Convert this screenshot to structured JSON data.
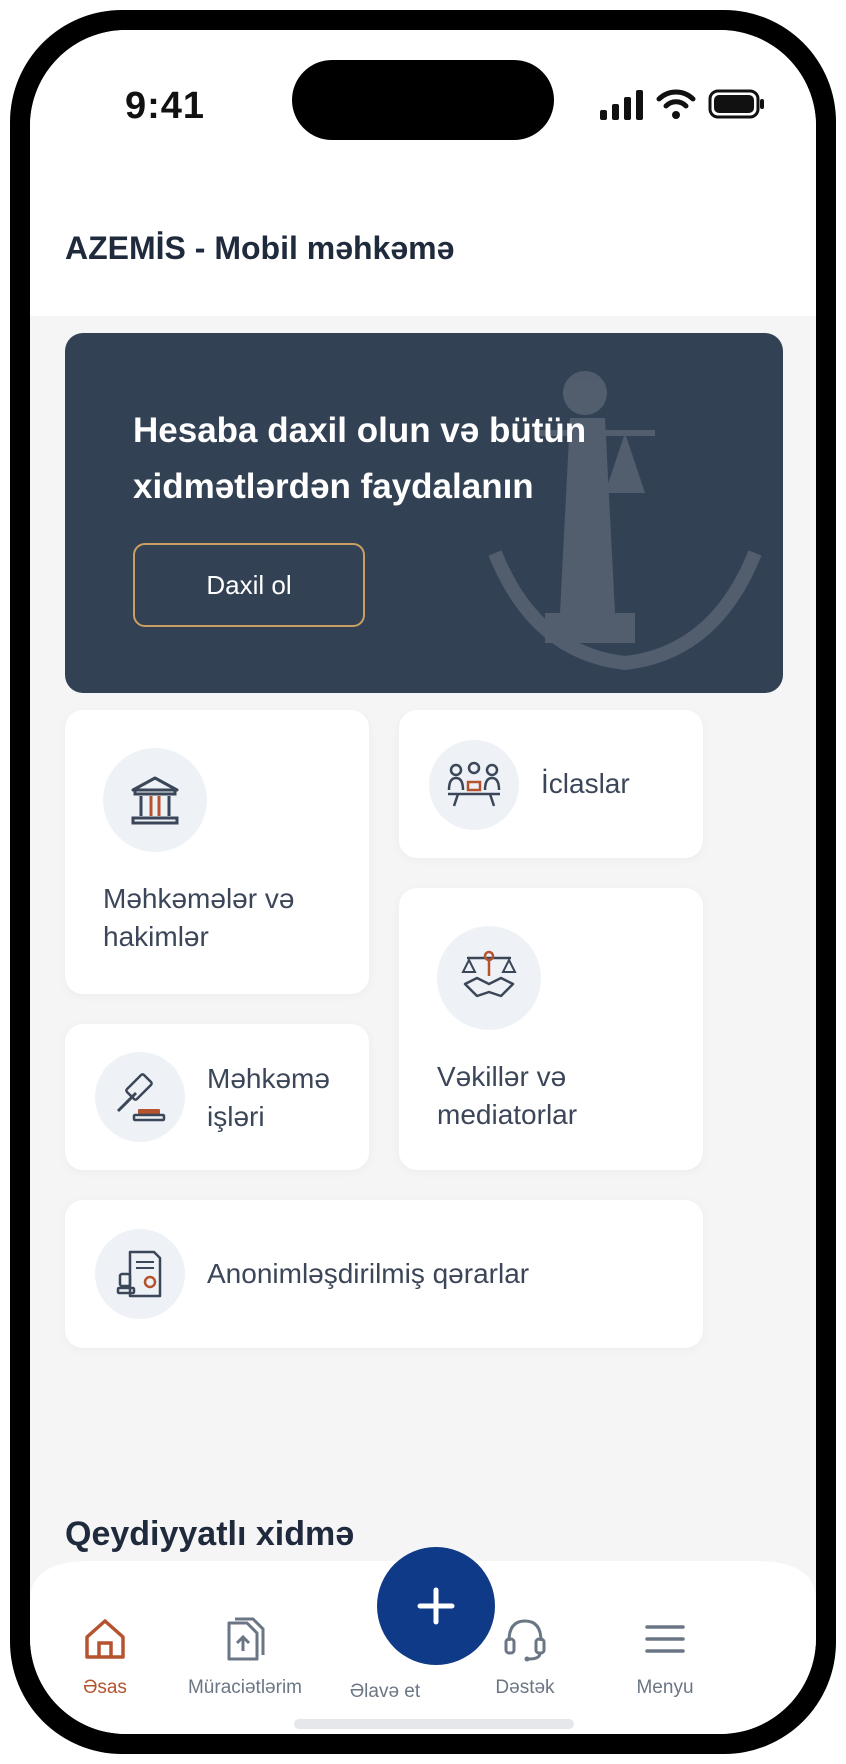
{
  "status": {
    "time": "9:41"
  },
  "header": {
    "title": "AZEMİS - Mobil məhkəmə"
  },
  "banner": {
    "text": "Hesaba daxil olun və bütün xidmətlərdən faydalanın",
    "button": "Daxil ol"
  },
  "cards": {
    "courts": "Məhkəmələr və hakimlər",
    "sessions": "İclaslar",
    "lawyers": "Vəkillər və mediatorlar",
    "cases": "Məhkəmə işləri",
    "decisions": "Anonimləşdirilmiş qərarlar"
  },
  "section": {
    "title": "Qeydiyyatlı xidmə"
  },
  "tabs": {
    "home": "Əsas",
    "requests": "Müraciətlərim",
    "add": "Əlavə et",
    "support": "Dəstək",
    "menu": "Menyu"
  },
  "colors": {
    "accent": "#b5532f",
    "primary": "#0f3a87",
    "banner": "#334155",
    "border_gold": "#c9a062"
  }
}
